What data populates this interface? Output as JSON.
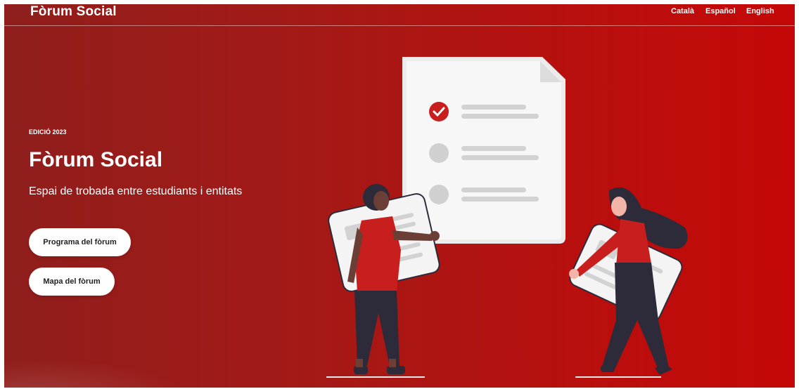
{
  "header": {
    "brand": "Fòrum Social",
    "languages": [
      "Català",
      "Español",
      "English"
    ]
  },
  "hero": {
    "edition": "EDICIÓ 2023",
    "title": "Fòrum Social",
    "subtitle": "Espai de trobada entre estudiants i entitats",
    "buttons": {
      "program": "Programa del fòrum",
      "map": "Mapa del fòrum"
    }
  },
  "colors": {
    "accent_red": "#c81e1e",
    "dark_figure": "#2d2b3a",
    "paper": "#f5f5f5"
  }
}
